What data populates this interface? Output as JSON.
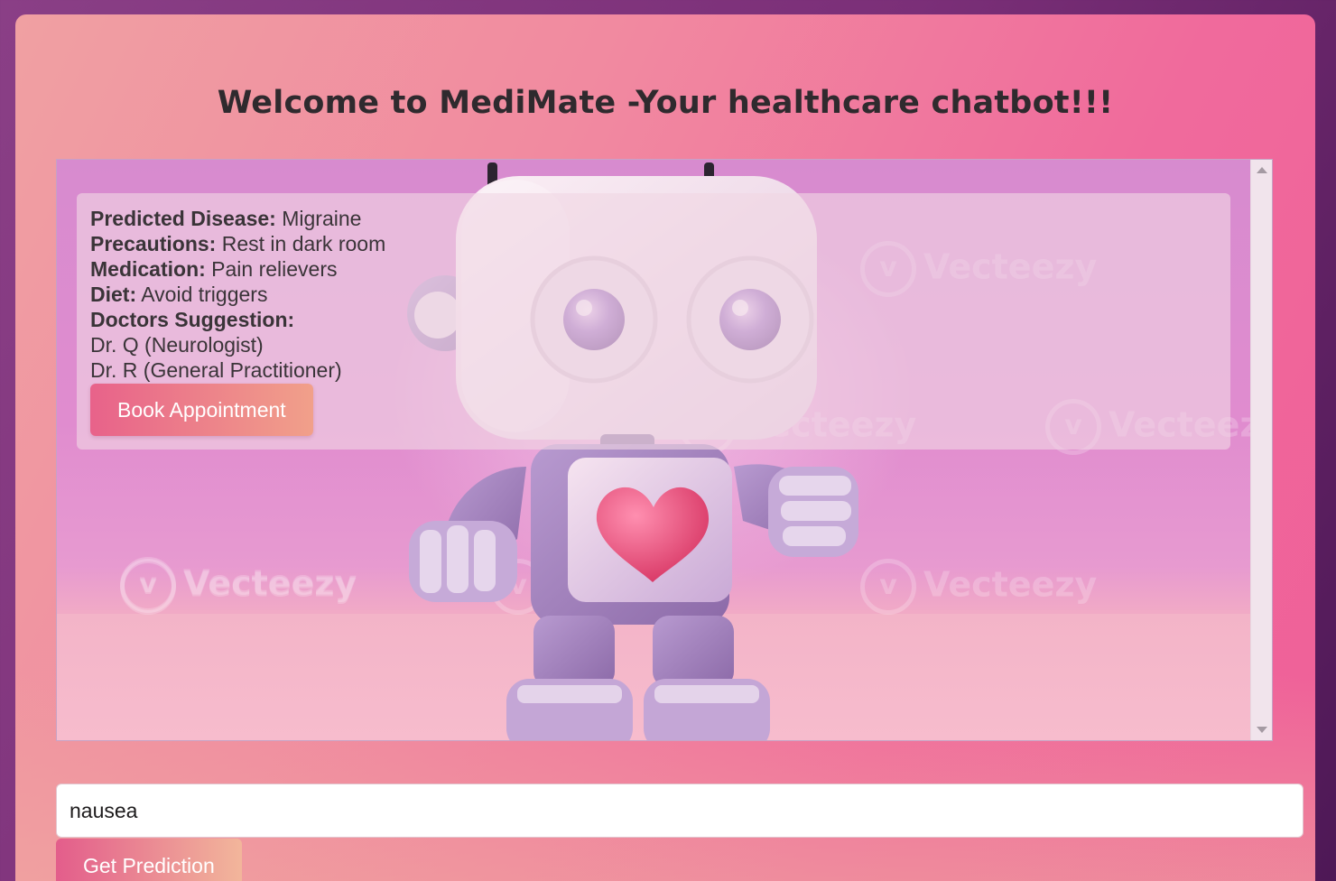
{
  "header": {
    "title": "Welcome to MediMate -Your healthcare chatbot!!!"
  },
  "chat": {
    "background_icon": "robot-with-heart-illustration",
    "watermark_text": "Vecteezy",
    "result": {
      "predicted_disease_label": "Predicted Disease:",
      "predicted_disease_value": "Migraine",
      "precautions_label": "Precautions:",
      "precautions_value": "Rest in dark room",
      "medication_label": "Medication:",
      "medication_value": "Pain relievers",
      "diet_label": "Diet:",
      "diet_value": "Avoid triggers",
      "doctors_label": "Doctors Suggestion:",
      "doctors": [
        "Dr. Q (Neurologist)",
        "Dr. R (General Practitioner)"
      ],
      "book_button_label": "Book Appointment"
    }
  },
  "input": {
    "value": "nausea"
  },
  "actions": {
    "predict_button_label": "Get Prediction"
  },
  "colors": {
    "accent_start": "#e8628a",
    "accent_end": "#f1a08a",
    "title_text": "#2f2a2e"
  }
}
